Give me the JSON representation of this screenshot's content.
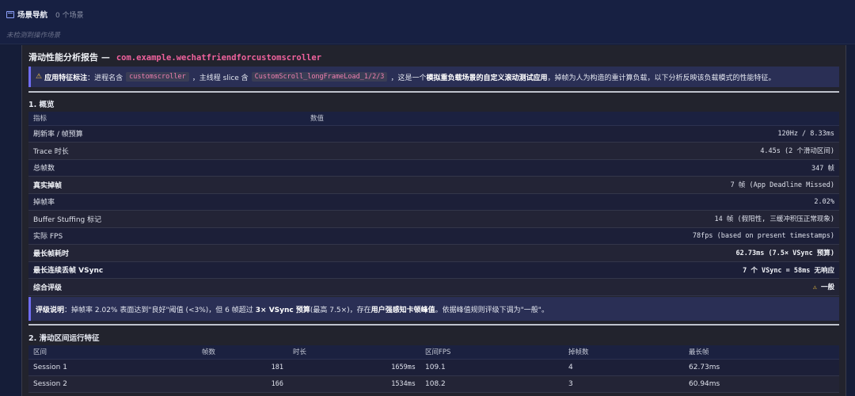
{
  "nav": {
    "title": "场景导航",
    "count": "0 个场景",
    "empty": "未检测到操作场景"
  },
  "report": {
    "title": "滑动性能分析报告 —",
    "package": "com.example.wechatfriendforcustomscroller"
  },
  "feature_note": {
    "label": "应用特征标注",
    "t1": "：进程名含",
    "code1": "customscroller",
    "t2": "，主线程 slice 含",
    "code2": "CustomScroll_longFrameLoad_1/2/3",
    "t3": "，这是一个",
    "bold1": "模拟重负载场景的自定义滚动测试应用",
    "t4": "，掉帧为人为构造的重计算负载，以下分析反映该负载模式的性能特征。"
  },
  "overview": {
    "section_title": "1. 概览",
    "col_metric": "指标",
    "col_value": "数值",
    "rows": [
      {
        "metric": "刷新率 / 帧预算",
        "value": "120Hz / 8.33ms"
      },
      {
        "metric": "Trace 时长",
        "value": "4.45s (2 个滑动区间)"
      },
      {
        "metric": "总帧数",
        "value": "347 帧"
      },
      {
        "metric": "真实掉帧",
        "value": "7 帧 (App Deadline Missed)"
      },
      {
        "metric": "掉帧率",
        "value": "2.02%"
      },
      {
        "metric": "Buffer Stuffing 标记",
        "value": "14 帧 (假阳性, 三缓冲积压正常现象)"
      },
      {
        "metric": "实际 FPS",
        "value": "78fps (based on present timestamps)"
      },
      {
        "metric": "最长帧耗时",
        "value": "62.73ms (7.5× VSync 预算)"
      },
      {
        "metric": "最长连续丢帧 VSync",
        "value": "7 个 VSync = 58ms 无响应"
      },
      {
        "metric": "综合评级",
        "value": "一般"
      }
    ]
  },
  "rating_note": {
    "label": "评级说明",
    "t1": "：掉帧率 2.02% 表面达到\"良好\"阈值 (<3%)，但 6 帧超过",
    "bold1": "3× VSync 预算",
    "t2": " (最高 7.5×)，存在",
    "bold2": "用户强感知卡顿峰值",
    "t3": "。依据峰值规则评级下调为\"一般\"。"
  },
  "sessions": {
    "section_title": "2. 滑动区间运行特征",
    "headers": [
      "区间",
      "帧数",
      "时长",
      "区间FPS",
      "掉帧数",
      "最长帧"
    ],
    "rows": [
      {
        "name": "Session 1",
        "frames": "181",
        "duration": "1659ms",
        "fps": "109.1",
        "drops": "4",
        "longest": "62.73ms"
      },
      {
        "name": "Session 2",
        "frames": "166",
        "duration": "1534ms",
        "fps": "108.2",
        "drops": "3",
        "longest": "60.94ms"
      }
    ]
  },
  "colors": {
    "background": "#151d38",
    "panel": "#22232d",
    "accent_pink": "#f0629d",
    "callout_border": "#6f6cf0",
    "warning": "#f5c542"
  }
}
